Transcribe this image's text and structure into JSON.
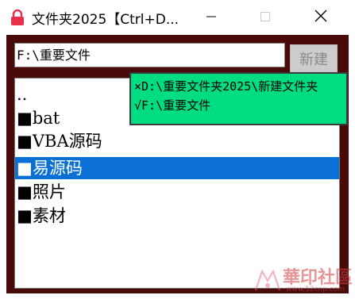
{
  "window": {
    "title": "文件夹2025【Ctrl+D..."
  },
  "toolbar": {
    "path_value": "F:\\重要文件",
    "new_button_label": "新建"
  },
  "file_list": {
    "items": [
      {
        "label": "..",
        "selected": false
      },
      {
        "label": "■bat",
        "selected": false
      },
      {
        "label": "■VBA源码",
        "selected": false
      },
      {
        "label": "■易源码",
        "selected": true
      },
      {
        "label": "■照片",
        "selected": false
      },
      {
        "label": "■素材",
        "selected": false
      }
    ]
  },
  "history_popup": {
    "items": [
      "×D:\\重要文件夹2025\\新建文件夹",
      "√F:\\重要文件"
    ]
  },
  "watermark": {
    "text": "華印社區",
    "url": "www.52cnp.com"
  },
  "colors": {
    "frame": "#4a0a0a",
    "selection": "#0a70d6",
    "popup": "#00dc82",
    "icon": "#e8304a"
  },
  "icons": {
    "app": "lock-icon",
    "minimize": "minimize-icon",
    "maximize": "maximize-icon",
    "close": "close-icon"
  }
}
